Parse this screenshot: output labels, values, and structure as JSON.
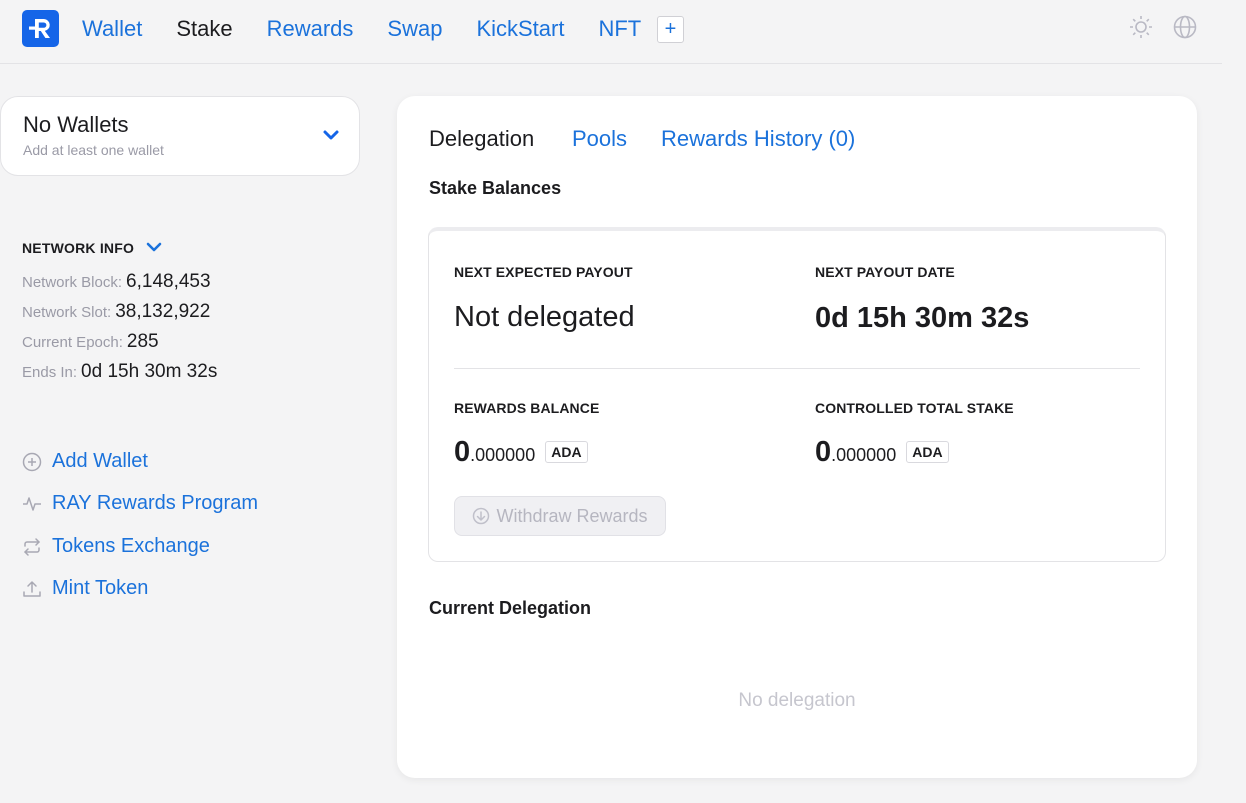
{
  "colors": {
    "accent": "#1b72db",
    "brand": "#1565e8",
    "muted": "#9a9aa6"
  },
  "header": {
    "logo_icon": "ray-logo-icon",
    "nav": [
      {
        "label": "Wallet",
        "active": false
      },
      {
        "label": "Stake",
        "active": true
      },
      {
        "label": "Rewards",
        "active": false
      },
      {
        "label": "Swap",
        "active": false
      },
      {
        "label": "KickStart",
        "active": false
      },
      {
        "label": "NFT",
        "active": false
      }
    ],
    "plus_label": "+",
    "theme_icon": "sun-icon",
    "language_icon": "globe-icon"
  },
  "wallet_selector": {
    "title": "No Wallets",
    "subtitle": "Add at least one wallet",
    "icon": "chevron-down-icon"
  },
  "network_info": {
    "title": "NETWORK INFO",
    "rows": [
      {
        "label": "Network Block:",
        "value": "6,148,453"
      },
      {
        "label": "Network Slot:",
        "value": "38,132,922"
      },
      {
        "label": "Current Epoch:",
        "value": "285"
      },
      {
        "label": "Ends In:",
        "value": "0d 15h 30m 32s"
      }
    ]
  },
  "side_links": [
    {
      "label": "Add Wallet",
      "icon": "plus-circle-icon"
    },
    {
      "label": "RAY Rewards Program",
      "icon": "activity-icon"
    },
    {
      "label": "Tokens Exchange",
      "icon": "exchange-icon"
    },
    {
      "label": "Mint Token",
      "icon": "upload-icon"
    }
  ],
  "main": {
    "tabs": [
      {
        "label": "Delegation",
        "active": true
      },
      {
        "label": "Pools",
        "active": false
      },
      {
        "label": "Rewards History (0)",
        "active": false
      }
    ],
    "stake_balances_title": "Stake Balances",
    "next_expected_payout": {
      "caption": "NEXT EXPECTED PAYOUT",
      "value": "Not delegated"
    },
    "next_payout_date": {
      "caption": "NEXT PAYOUT DATE",
      "value": "0d 15h 30m 32s"
    },
    "rewards_balance": {
      "caption": "REWARDS BALANCE",
      "int": "0",
      "dec": ".000000",
      "unit": "ADA"
    },
    "controlled_total_stake": {
      "caption": "CONTROLLED TOTAL STAKE",
      "int": "0",
      "dec": ".000000",
      "unit": "ADA"
    },
    "withdraw_button": "Withdraw Rewards",
    "current_delegation_title": "Current Delegation",
    "no_delegation_text": "No delegation"
  }
}
